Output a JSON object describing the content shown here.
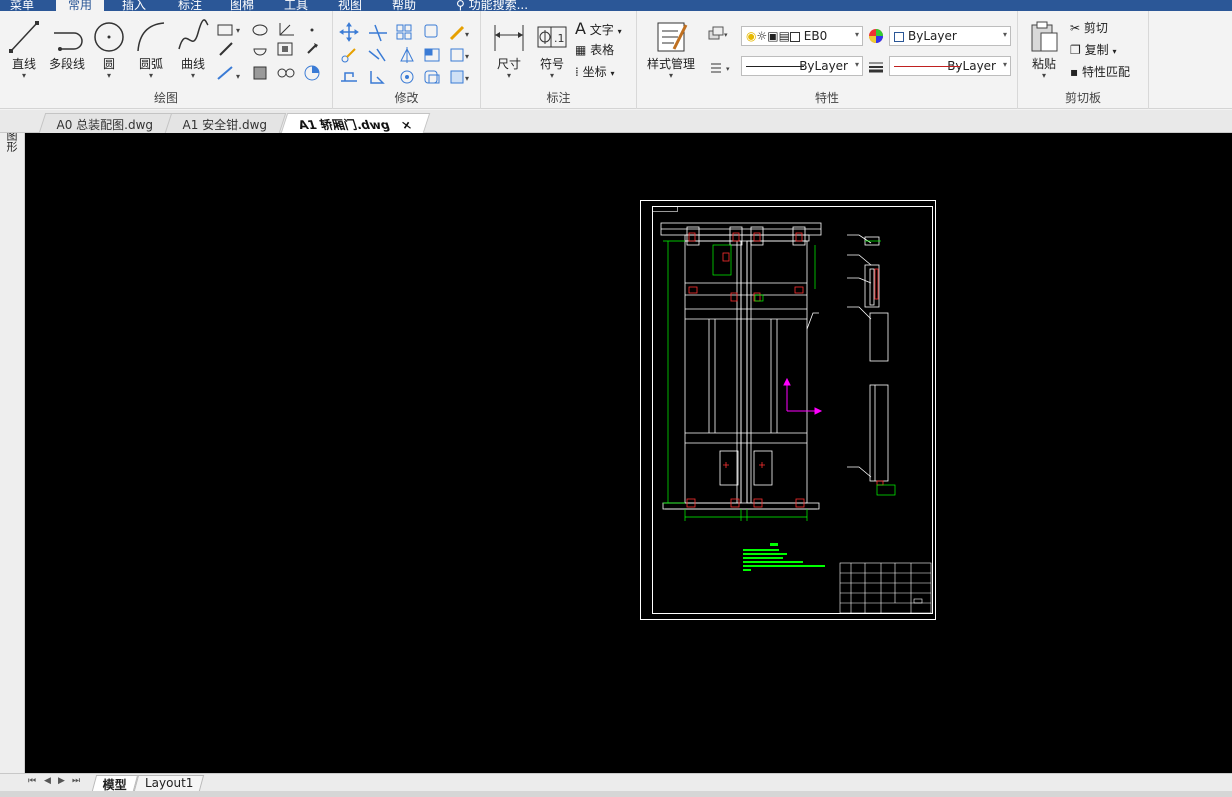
{
  "menu_tabs": [
    "菜单",
    "常用",
    "插入",
    "标注",
    "图棉",
    "工具",
    "视图",
    "帮助"
  ],
  "search": {
    "placeholder": "功能搜索..."
  },
  "groups": {
    "draw": {
      "label": "绘图",
      "tools": [
        {
          "label": "直线",
          "icon": "line-icon"
        },
        {
          "label": "多段线",
          "icon": "polyline-icon"
        },
        {
          "label": "圆",
          "icon": "circle-icon"
        },
        {
          "label": "圆弧",
          "icon": "arc-icon"
        },
        {
          "label": "曲线",
          "icon": "spline-icon"
        }
      ]
    },
    "modify": {
      "label": "修改"
    },
    "annotate": {
      "label": "标注",
      "tools": [
        {
          "label": "尺寸",
          "icon": "dimension-icon"
        },
        {
          "label": "符号",
          "icon": "symbol-icon"
        }
      ],
      "text_label": "文字",
      "table_label": "表格",
      "coord_label": "坐标"
    },
    "properties": {
      "label": "特性",
      "style_manager": "样式管理",
      "layer_value": "EB0",
      "color_value": "ByLayer",
      "linetype_value": "ByLayer",
      "lineweight_value": "ByLayer"
    },
    "clipboard": {
      "label": "剪切板",
      "paste": "粘贴",
      "cut": "剪切",
      "copy": "复制",
      "match": "特性匹配"
    }
  },
  "doc_tabs": [
    {
      "label": "A0 总装配图.dwg",
      "active": false
    },
    {
      "label": "A1 安全钳.dwg",
      "active": false
    },
    {
      "label": "A1 轿厢门.dwg",
      "active": true
    }
  ],
  "doc_tab_close": "×",
  "left_panel_label": "图形",
  "layout_tabs": [
    {
      "label": "模型",
      "active": true
    },
    {
      "label": "Layout1",
      "active": false
    }
  ],
  "colors": {
    "menu_bg": "#2b5797",
    "canvas_bg": "#000000",
    "drawing_lines": "#ffffff",
    "dimension": "#00ff00",
    "hatch_red": "#ff3030",
    "ucs": "#ff00ff"
  }
}
